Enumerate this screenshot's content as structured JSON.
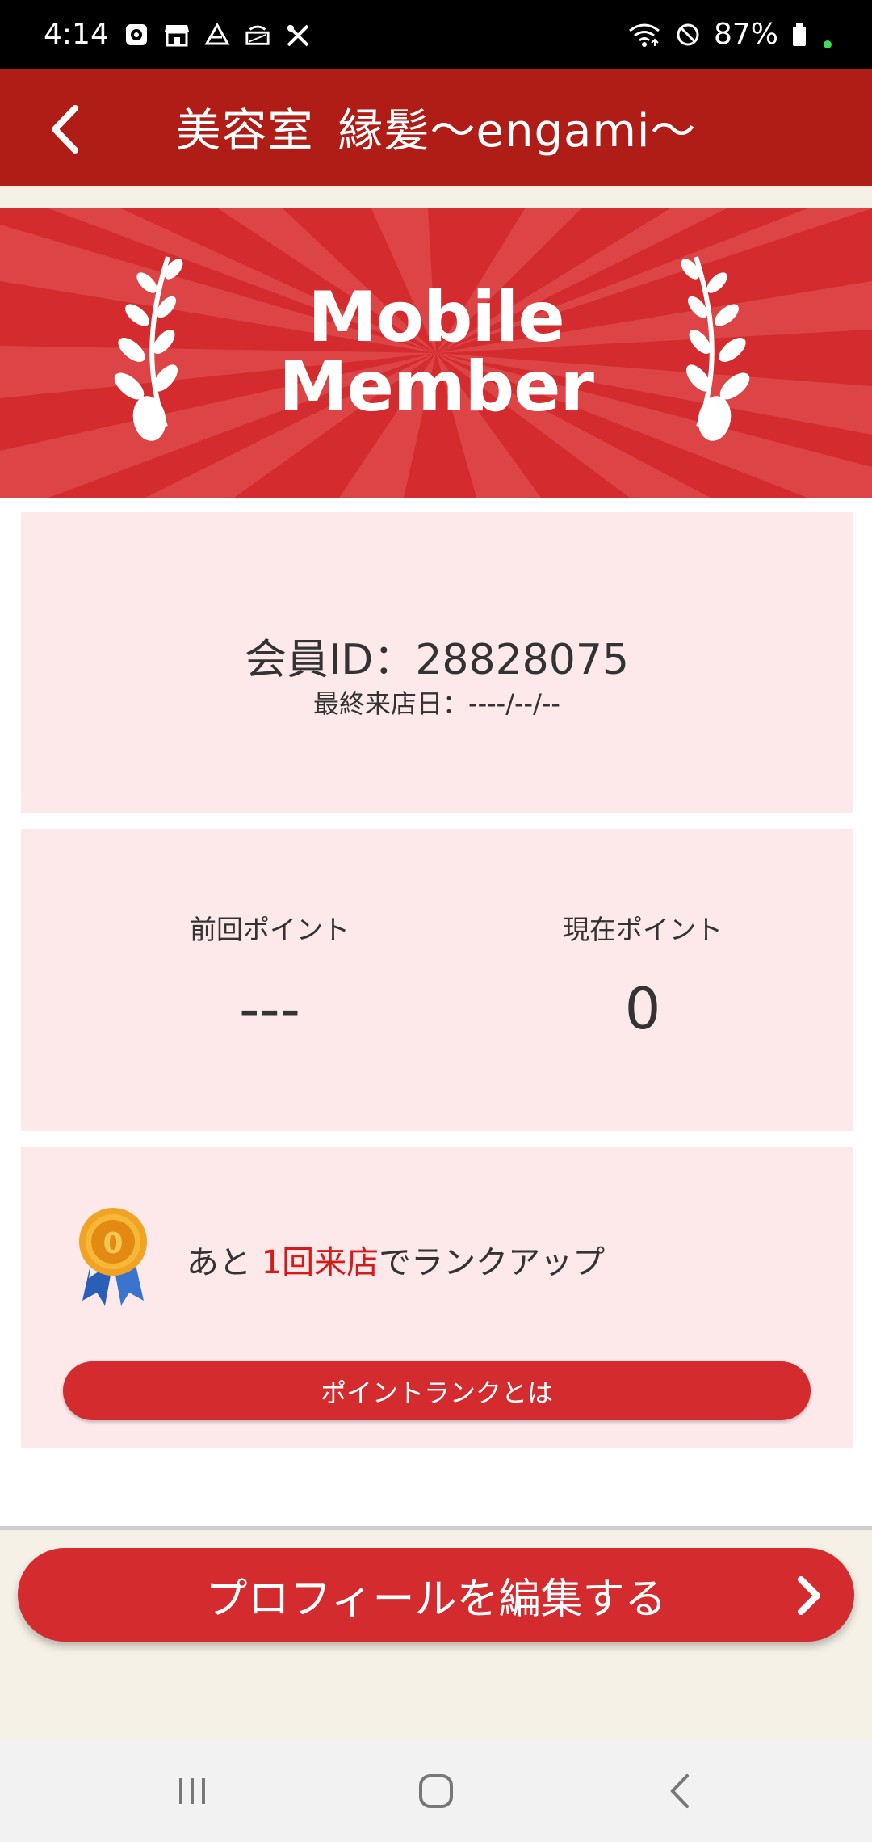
{
  "status_bar": {
    "time": "4:14",
    "battery": "87%",
    "left_icons": [
      "clock-app-icon",
      "store-icon",
      "drive-icon",
      "router-icon",
      "tools-icon"
    ],
    "right_icons": [
      "wifi-icon",
      "do-not-disturb-icon",
      "battery-icon"
    ]
  },
  "header": {
    "title_part1": "美容室",
    "title_part2": "縁髪〜engami〜",
    "back_icon": "chevron-left-icon"
  },
  "banner": {
    "line1": "Mobile",
    "line2": "Member",
    "colors": {
      "background": "#d32b2e",
      "rays": "#e04a4b"
    }
  },
  "member": {
    "id_label": "会員ID：28828075",
    "last_visit": "最終来店日：----/--/--"
  },
  "points": {
    "previous_label": "前回ポイント",
    "previous_value": "---",
    "current_label": "現在ポイント",
    "current_value": "0"
  },
  "rank": {
    "text_prefix": "あと ",
    "text_accent": "1回来店",
    "text_suffix": "でランクアップ",
    "button_label": "ポイントランクとは",
    "medal_number": "0"
  },
  "profile": {
    "button_label": "プロフィールを編集する"
  },
  "colors": {
    "header": "#b01d16",
    "accent": "#d32b2e",
    "card": "#fde8ea",
    "accent_text": "#d21b1b"
  }
}
